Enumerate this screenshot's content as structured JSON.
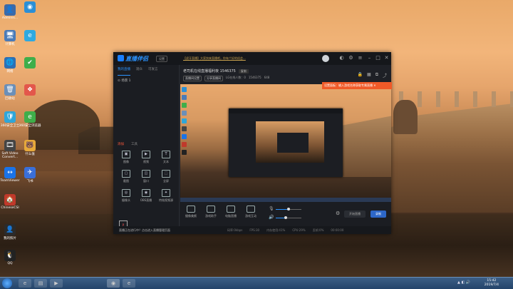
{
  "desktop": {
    "icons": [
      {
        "label": "Adminis...",
        "glyph": "👤",
        "color": "#3b6aa8"
      },
      {
        "label": "计算机",
        "glyph": "🖥",
        "color": "#4a7bb8"
      },
      {
        "label": "网络",
        "glyph": "🌐",
        "color": "#2d6fb4"
      },
      {
        "label": "回收站",
        "glyph": "🗑",
        "color": "#6b8fb8"
      },
      {
        "label": "360安全卫士",
        "glyph": "🛡",
        "color": "#2fa6d8"
      },
      {
        "label": "Soft Video Convert...",
        "glyph": "🎞",
        "color": "#444"
      },
      {
        "label": "TeamViewer",
        "glyph": "↔",
        "color": "#1a73e8"
      },
      {
        "label": "ChineseCSI",
        "glyph": "🏠",
        "color": "#c0392b"
      },
      {
        "label": "我的照片",
        "glyph": "👤",
        "color": "#2b2b2b"
      },
      {
        "label": "QQ",
        "glyph": "🐧",
        "color": "#222"
      }
    ],
    "icons_col2": [
      {
        "label": "",
        "glyph": "◉",
        "color": "#2b8fd6"
      },
      {
        "label": "",
        "glyph": "e",
        "color": "#2fa9e0"
      },
      {
        "label": "",
        "glyph": "✔",
        "color": "#3fae4a"
      },
      {
        "label": "",
        "glyph": "❖",
        "color": "#e3574b"
      },
      {
        "label": "360安全浏览器",
        "glyph": "e",
        "color": "#3fae4a"
      },
      {
        "label": "什么值",
        "glyph": "🐻",
        "color": "#e7a93b"
      },
      {
        "label": "飞书",
        "glyph": "✈",
        "color": "#3a6fd8"
      }
    ]
  },
  "app": {
    "name": "直播伴侣",
    "tag": "设置",
    "notice": "【虎牙直播】大家快来直播吧，你有个好的机会...",
    "left_tabs": [
      "我的直播",
      "观众",
      "可发言"
    ],
    "scene": "场景 1",
    "sub_tabs": [
      "添加",
      "工具"
    ],
    "sources": [
      {
        "label": "图像",
        "glyph": "▣"
      },
      {
        "label": "视频",
        "glyph": "▶"
      },
      {
        "label": "文本",
        "glyph": "T"
      },
      {
        "label": "截图",
        "glyph": "▢"
      },
      {
        "label": "窗口",
        "glyph": "◫"
      },
      {
        "label": "全屏",
        "glyph": "⬚"
      },
      {
        "label": "摄像头",
        "glyph": "◎"
      },
      {
        "label": "OBS直播",
        "glyph": "◉"
      },
      {
        "label": "特效视频源",
        "glyph": "✦"
      }
    ],
    "ppt_label": "PPT",
    "room_title": "老司机在线直播福利夜 1546375",
    "copy_btn": "复制",
    "meta": [
      "直播间设置",
      "分享直播间",
      "LG在线人数：0",
      "1546375",
      "648"
    ],
    "notification": "设置面板：输入游戏名称获取专属直播",
    "bottom": {
      "items": [
        "摄像美颜",
        "游戏助手",
        "电脑直播",
        "游戏互动"
      ],
      "start_live": "开始直播",
      "record": "录制"
    },
    "status": {
      "left": "直播正在进行中？点击进入直播管理页面",
      "right": [
        "码率:0kbps",
        "FPS:30",
        "内存使用:41%",
        "CPU:29%",
        "丢帧:0%",
        "00:00:00"
      ]
    }
  },
  "taskbar": {
    "clock_time": "15:42",
    "clock_date": "2019/7/4"
  }
}
